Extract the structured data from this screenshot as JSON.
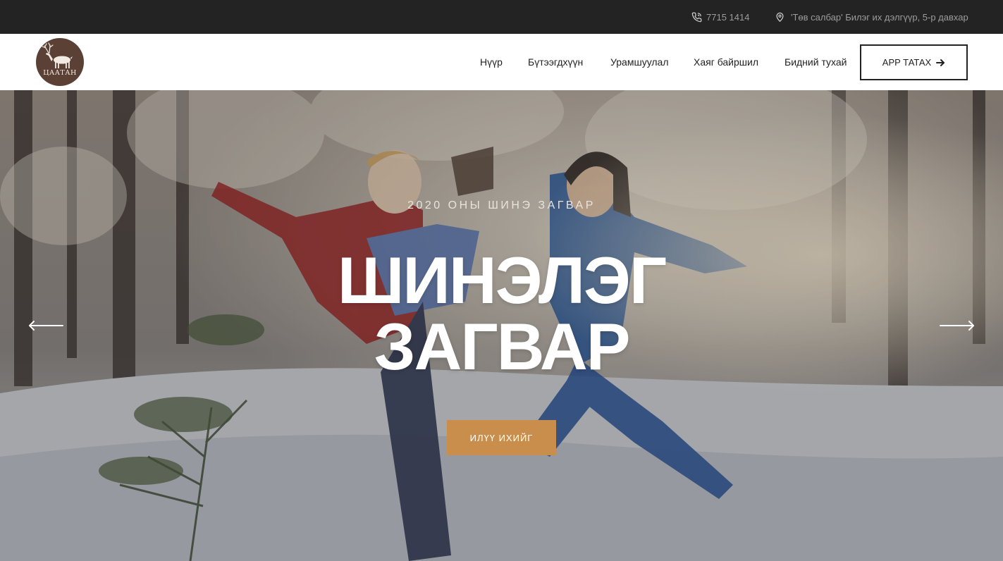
{
  "topbar": {
    "phone": "7715 1414",
    "address": "'Төв салбар' Билэг их дэлгүүр, 5-р давхар",
    "phone_icon": "phone-icon",
    "address_icon": "location-pin-icon"
  },
  "header": {
    "logo_text": "ЦААТАН",
    "nav": [
      {
        "label": "Нүүр"
      },
      {
        "label": "Бүтээгдхүүн"
      },
      {
        "label": "Урамшуулал"
      },
      {
        "label": "Хаяг байршил"
      },
      {
        "label": "Бидний тухай"
      }
    ],
    "app_button": "APP ТАТАХ",
    "app_button_icon": "arrow-right-icon"
  },
  "hero": {
    "subtitle": "2020 ОНЫ ШИНЭ ЗАГВАР",
    "title_line1": "ШИНЭЛЭГ",
    "title_line2": "ЗАГВАР",
    "cta": "ИЛҮҮ ИХИЙГ",
    "prev_icon": "arrow-left-icon",
    "next_icon": "arrow-right-long-icon"
  },
  "colors": {
    "topbar_bg": "#232323",
    "topbar_text": "#9c9c9c",
    "accent": "#c98e4b",
    "logo_bg": "#5b4035"
  }
}
